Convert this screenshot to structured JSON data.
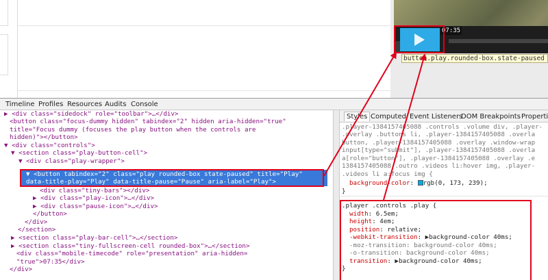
{
  "video": {
    "timecode": "07:35",
    "tooltip": "button.play.rounded-box.state-paused"
  },
  "devtools": {
    "tabs": [
      "Timeline",
      "Profiles",
      "Resources",
      "Audits",
      "Console"
    ],
    "sidebar_tabs": [
      "Styles",
      "Computed",
      "Event Listeners",
      "DOM Breakpoints",
      "Properties"
    ]
  },
  "dom_lines": [
    "▶ <div class=\"sidedock\" role=\"toolbar\">…</div>",
    "<button class=\"focus-dummy hidden\" tabindex=\"2\" hidden aria-hidden=\"true\"",
    "title=\"Focus dummy (focuses the play button when the controls are",
    "hidden)\"></button>",
    "▼ <div class=\"controls\">",
    "▼ <section class=\"play-button-cell\">",
    "▼ <div class=\"play-wrapper\">",
    "▼ <button tabindex=\"2\" class=\"play rounded-box state-paused\" title=\"Play\"",
    "data-title-play=\"Play\" data-title-pause=\"Pause\" aria-label=\"Play\">",
    "<div class=\"tiny-bars\"></div>",
    "▶ <div class=\"play-icon\">…</div>",
    "▶ <div class=\"pause-icon\">…</div>",
    "</button>",
    "</div>",
    "</section>",
    "▶ <section class=\"play-bar-cell\">…</section>",
    "▶ <section class=\"tiny-fullscreen-cell rounded-box\">…</section>",
    "<div class=\"mobile-timecode\" role=\"presentation\" aria-hidden=",
    "\"true\">07:35</div>",
    "</div>"
  ],
  "style_lines": [
    ".player-1384157405088 .controls .volume div, .player-",
    ".overlay .buttons li, .player-1384157405088 .overla",
    "button, .player-1384157405088 .overlay .window-wrap",
    "input[type=\"submit\"], .player-1384157405088 .overla",
    "a[role=\"button\"], .player-1384157405088 .overlay .e",
    "1384157405088 .outro .videos li:hover img, .player-",
    ".videos li a:focus img {"
  ],
  "style_rule1": {
    "prop": "background-color",
    "value": "rgb(0, 173, 239);",
    "close": "}"
  },
  "style_rule2": {
    "selector": ".player .controls .play {",
    "decls": [
      {
        "prop": "width",
        "value": "6.5em;"
      },
      {
        "prop": "height",
        "value": "4em;"
      },
      {
        "prop": "position",
        "value": "relative;"
      },
      {
        "prop": "-webkit-transition",
        "value": "▶background-color 40ms;"
      },
      {
        "prop": "-moz-transition",
        "value": "background-color 40ms;"
      },
      {
        "prop": "-o-transition",
        "value": "background-color 40ms;"
      },
      {
        "prop": "transition",
        "value": "▶background-color 40ms;"
      }
    ],
    "close": "}"
  },
  "colors": {
    "play_button": "#2eaae7",
    "selection": "#3879d9",
    "highlight": "#e0001b",
    "swatch": "#00ade8"
  }
}
